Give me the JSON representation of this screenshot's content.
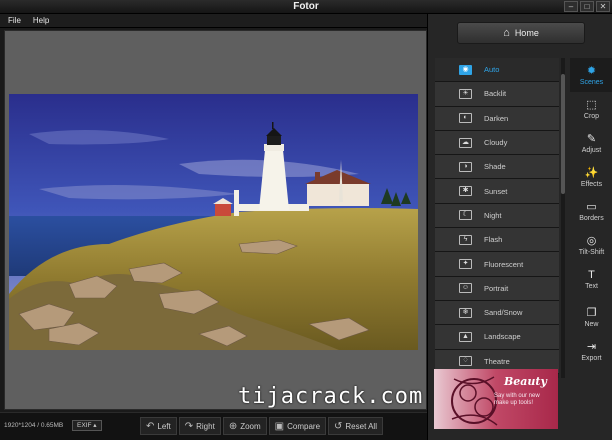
{
  "window": {
    "title": "Fotor",
    "buttons": [
      "–",
      "□",
      "✕"
    ]
  },
  "menu": [
    "File",
    "Help"
  ],
  "status": {
    "file_info": "1920*1204 / 0.65MB",
    "exif_label": "EXIF ▴"
  },
  "toolbar": [
    {
      "label": "Left",
      "icon": "rotate-left-icon",
      "glyph": "↶"
    },
    {
      "label": "Right",
      "icon": "rotate-right-icon",
      "glyph": "↷"
    },
    {
      "label": "Zoom",
      "icon": "zoom-icon",
      "glyph": "⊕"
    },
    {
      "label": "Compare",
      "icon": "compare-icon",
      "glyph": "▣"
    },
    {
      "label": "Reset All",
      "icon": "reset-icon",
      "glyph": "↺"
    }
  ],
  "home_label": "Home",
  "scenes": [
    {
      "label": "Auto",
      "glyph": "◉"
    },
    {
      "label": "Backlit",
      "glyph": "☀"
    },
    {
      "label": "Darken",
      "glyph": "◐"
    },
    {
      "label": "Cloudy",
      "glyph": "☁"
    },
    {
      "label": "Shade",
      "glyph": "◑"
    },
    {
      "label": "Sunset",
      "glyph": "✱"
    },
    {
      "label": "Night",
      "glyph": "☾"
    },
    {
      "label": "Flash",
      "glyph": "ϟ"
    },
    {
      "label": "Fluorescent",
      "glyph": "✦"
    },
    {
      "label": "Portrait",
      "glyph": "☺"
    },
    {
      "label": "Sand/Snow",
      "glyph": "❄"
    },
    {
      "label": "Landscape",
      "glyph": "▲"
    },
    {
      "label": "Theatre",
      "glyph": "♢"
    }
  ],
  "active_scene": "Auto",
  "nav": [
    {
      "label": "Scenes",
      "glyph": "✹"
    },
    {
      "label": "Crop",
      "glyph": "⬚"
    },
    {
      "label": "Adjust",
      "glyph": "✎"
    },
    {
      "label": "Effects",
      "glyph": "✨"
    },
    {
      "label": "Borders",
      "glyph": "▭"
    },
    {
      "label": "Tilt-Shift",
      "glyph": "◎"
    },
    {
      "label": "Text",
      "glyph": "T"
    },
    {
      "label": "New",
      "glyph": "❐"
    },
    {
      "label": "Export",
      "glyph": "⇥"
    }
  ],
  "active_nav": "Scenes",
  "ad": {
    "title": "Beauty",
    "body": "Say with our new make up tools!"
  },
  "watermark": "tijacrack.com",
  "colors": {
    "accent": "#2fa4e7",
    "panel": "#262626",
    "canvas": "#5f5f5f"
  }
}
